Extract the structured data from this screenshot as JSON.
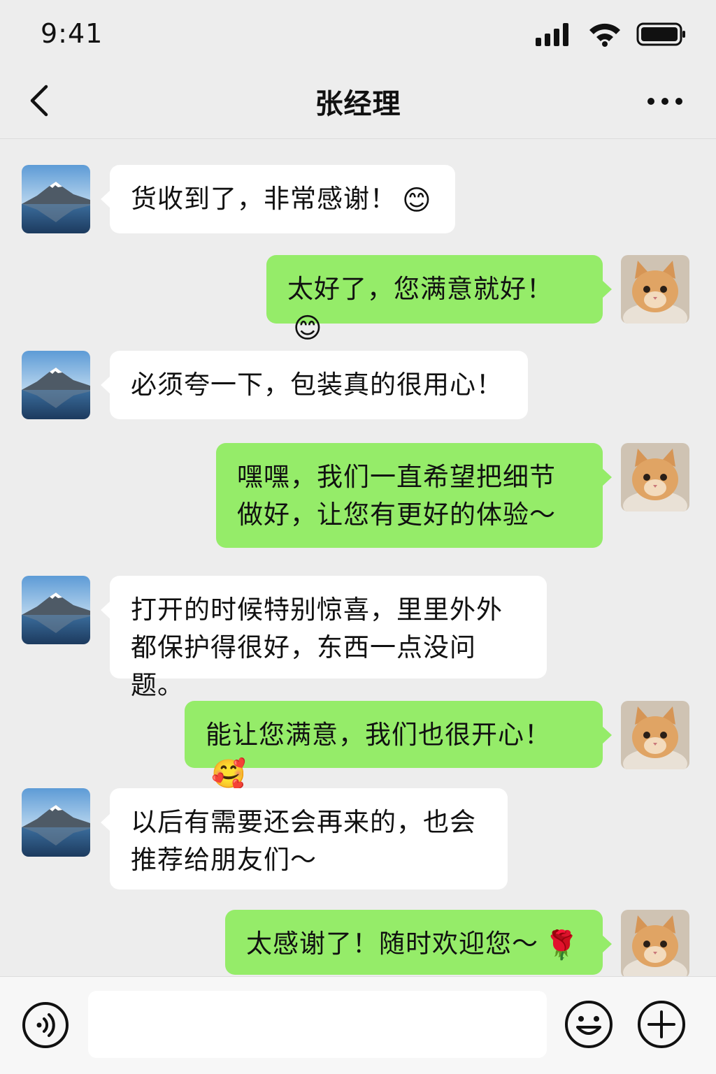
{
  "status_bar": {
    "time": "9:41",
    "icons": [
      "signal-icon",
      "wifi-icon",
      "battery-icon"
    ]
  },
  "header": {
    "title": "张经理",
    "back_icon": "chevron-left-icon",
    "more_icon": "more-dots-icon"
  },
  "messages": [
    {
      "side": "left",
      "avatar": "mountain-lake-avatar",
      "text": "货收到了，非常感谢！",
      "emoji": "😊"
    },
    {
      "side": "right",
      "avatar": "cat-avatar",
      "text": "太好了，您满意就好！",
      "emoji": "😊"
    },
    {
      "side": "left",
      "avatar": "mountain-lake-avatar",
      "text": "必须夸一下，包装真的很用心！",
      "emoji": ""
    },
    {
      "side": "right",
      "avatar": "cat-avatar",
      "lines": [
        "嘿嘿，我们一直希望把细节",
        "做好，让您有更好的体验～"
      ]
    },
    {
      "side": "left",
      "avatar": "mountain-lake-avatar",
      "lines": [
        "打开的时候特别惊喜，里里外外",
        "都保护得很好，东西一点没问题。"
      ]
    },
    {
      "side": "right",
      "avatar": "cat-avatar",
      "text": "能让您满意，我们也很开心！",
      "emoji": "🥰"
    },
    {
      "side": "left",
      "avatar": "mountain-lake-avatar",
      "lines": [
        "以后有需要还会再来的，也会",
        "推荐给朋友们～"
      ]
    },
    {
      "side": "right",
      "avatar": "cat-avatar",
      "text": "太感谢了！随时欢迎您～",
      "emoji": "🌹"
    }
  ],
  "input_bar": {
    "voice_icon": "voice-icon",
    "message_value": "",
    "emoji_icon": "smiley-icon",
    "add_icon": "plus-circle-icon"
  },
  "colors": {
    "background": "#ededed",
    "bubble_self": "#95ec69",
    "bubble_other": "#ffffff"
  }
}
